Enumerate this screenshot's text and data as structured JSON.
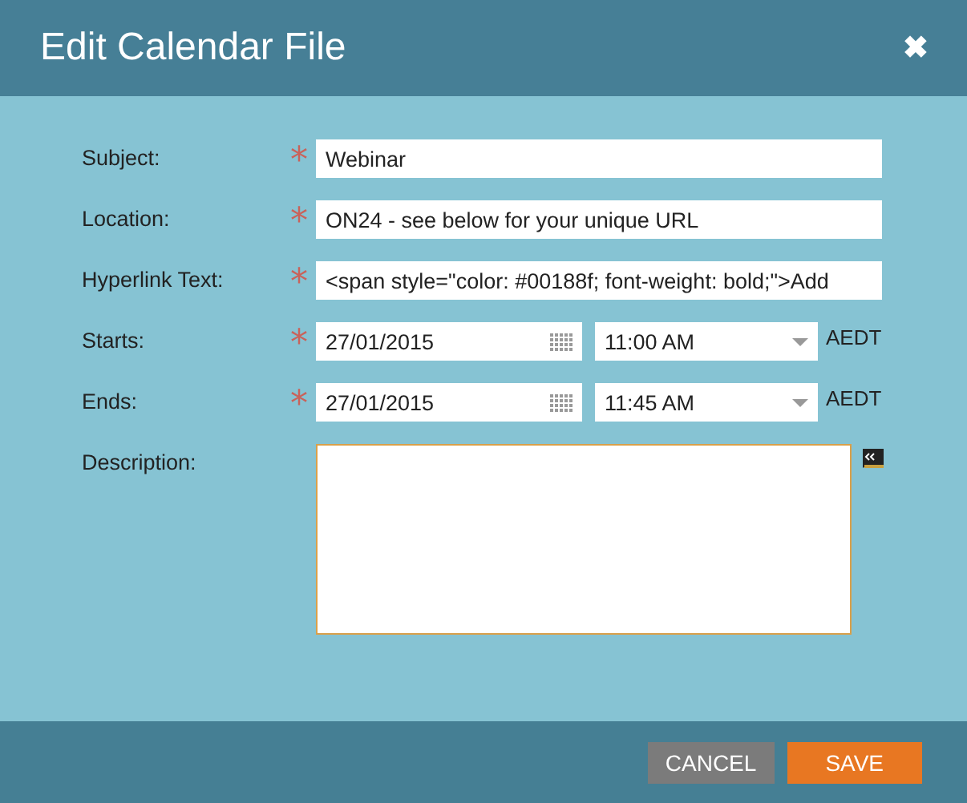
{
  "dialog": {
    "title": "Edit Calendar File",
    "close": "✖"
  },
  "fields": [
    {
      "kind": "text",
      "label": "Subject:",
      "required_mark": "*",
      "value": "Webinar"
    },
    {
      "kind": "text",
      "label": "Location:",
      "required_mark": "*",
      "value": "ON24 - see below for your unique URL"
    },
    {
      "kind": "text",
      "label": "Hyperlink Text:",
      "required_mark": "*",
      "value": "<span style=\"color: #00188f; font-weight: bold;\">Add"
    },
    {
      "kind": "datetime",
      "label": "Starts:",
      "required_mark": "*",
      "date": "27/01/2015",
      "time": "11:00 AM",
      "zone": "AEDT"
    },
    {
      "kind": "datetime",
      "label": "Ends:",
      "required_mark": "*",
      "date": "27/01/2015",
      "time": "11:45 AM",
      "zone": "AEDT"
    },
    {
      "kind": "textarea",
      "label": "Description:"
    }
  ],
  "buttons": [
    {
      "kind": "cancel",
      "label": "CANCEL"
    },
    {
      "kind": "save",
      "label": "SAVE"
    }
  ]
}
